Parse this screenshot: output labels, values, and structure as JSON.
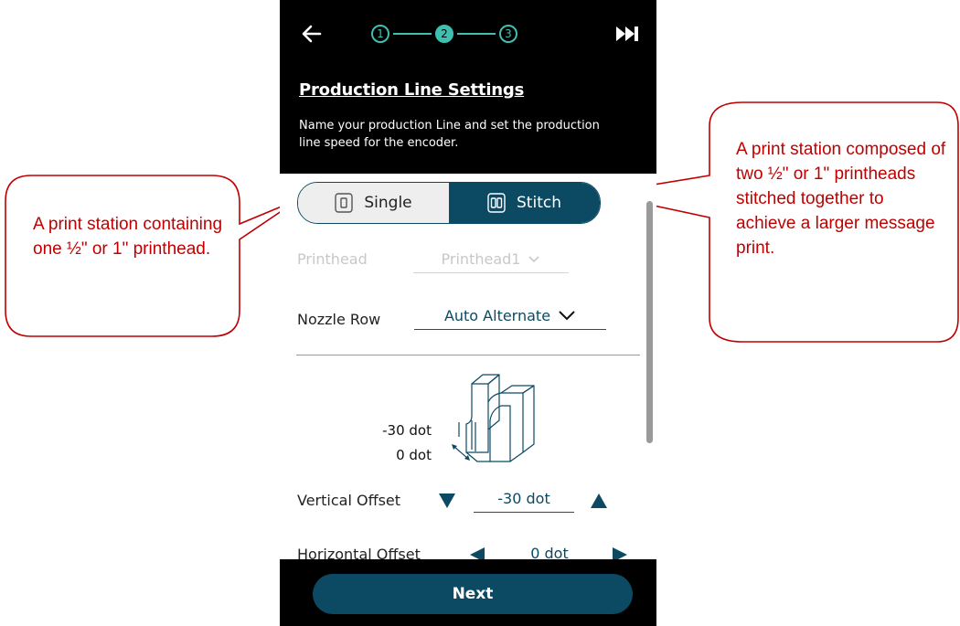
{
  "header": {
    "steps": [
      "1",
      "2",
      "3"
    ],
    "active_step": 2,
    "title": "Production Line Settings",
    "description": "Name your production Line and set the production line speed for the encoder."
  },
  "mode_toggle": {
    "options": [
      {
        "label": "Single",
        "icon": "single-printhead-icon",
        "selected": false
      },
      {
        "label": "Stitch",
        "icon": "stitch-printhead-icon",
        "selected": true
      }
    ]
  },
  "printhead": {
    "label": "Printhead",
    "value": "Printhead1",
    "disabled": true
  },
  "nozzle_row": {
    "label": "Nozzle Row",
    "value": "Auto Alternate"
  },
  "diagram": {
    "vertical_dot_label": "-30 dot",
    "horizontal_dot_label": "0 dot"
  },
  "vertical_offset": {
    "label": "Vertical Offset",
    "value": "-30 dot"
  },
  "horizontal_offset": {
    "label": "Horizontal Offset",
    "value": "0 dot"
  },
  "footer": {
    "next_label": "Next"
  },
  "callouts": {
    "single": "A print station containing one ½\" or 1\" printhead.",
    "stitch": "A print station composed of two ½\" or 1\" printheads stitched together to achieve a larger message print."
  },
  "colors": {
    "accent": "#0c4a63",
    "step": "#3fbfb0",
    "callout": "#c00000",
    "header_bg": "#000000"
  }
}
